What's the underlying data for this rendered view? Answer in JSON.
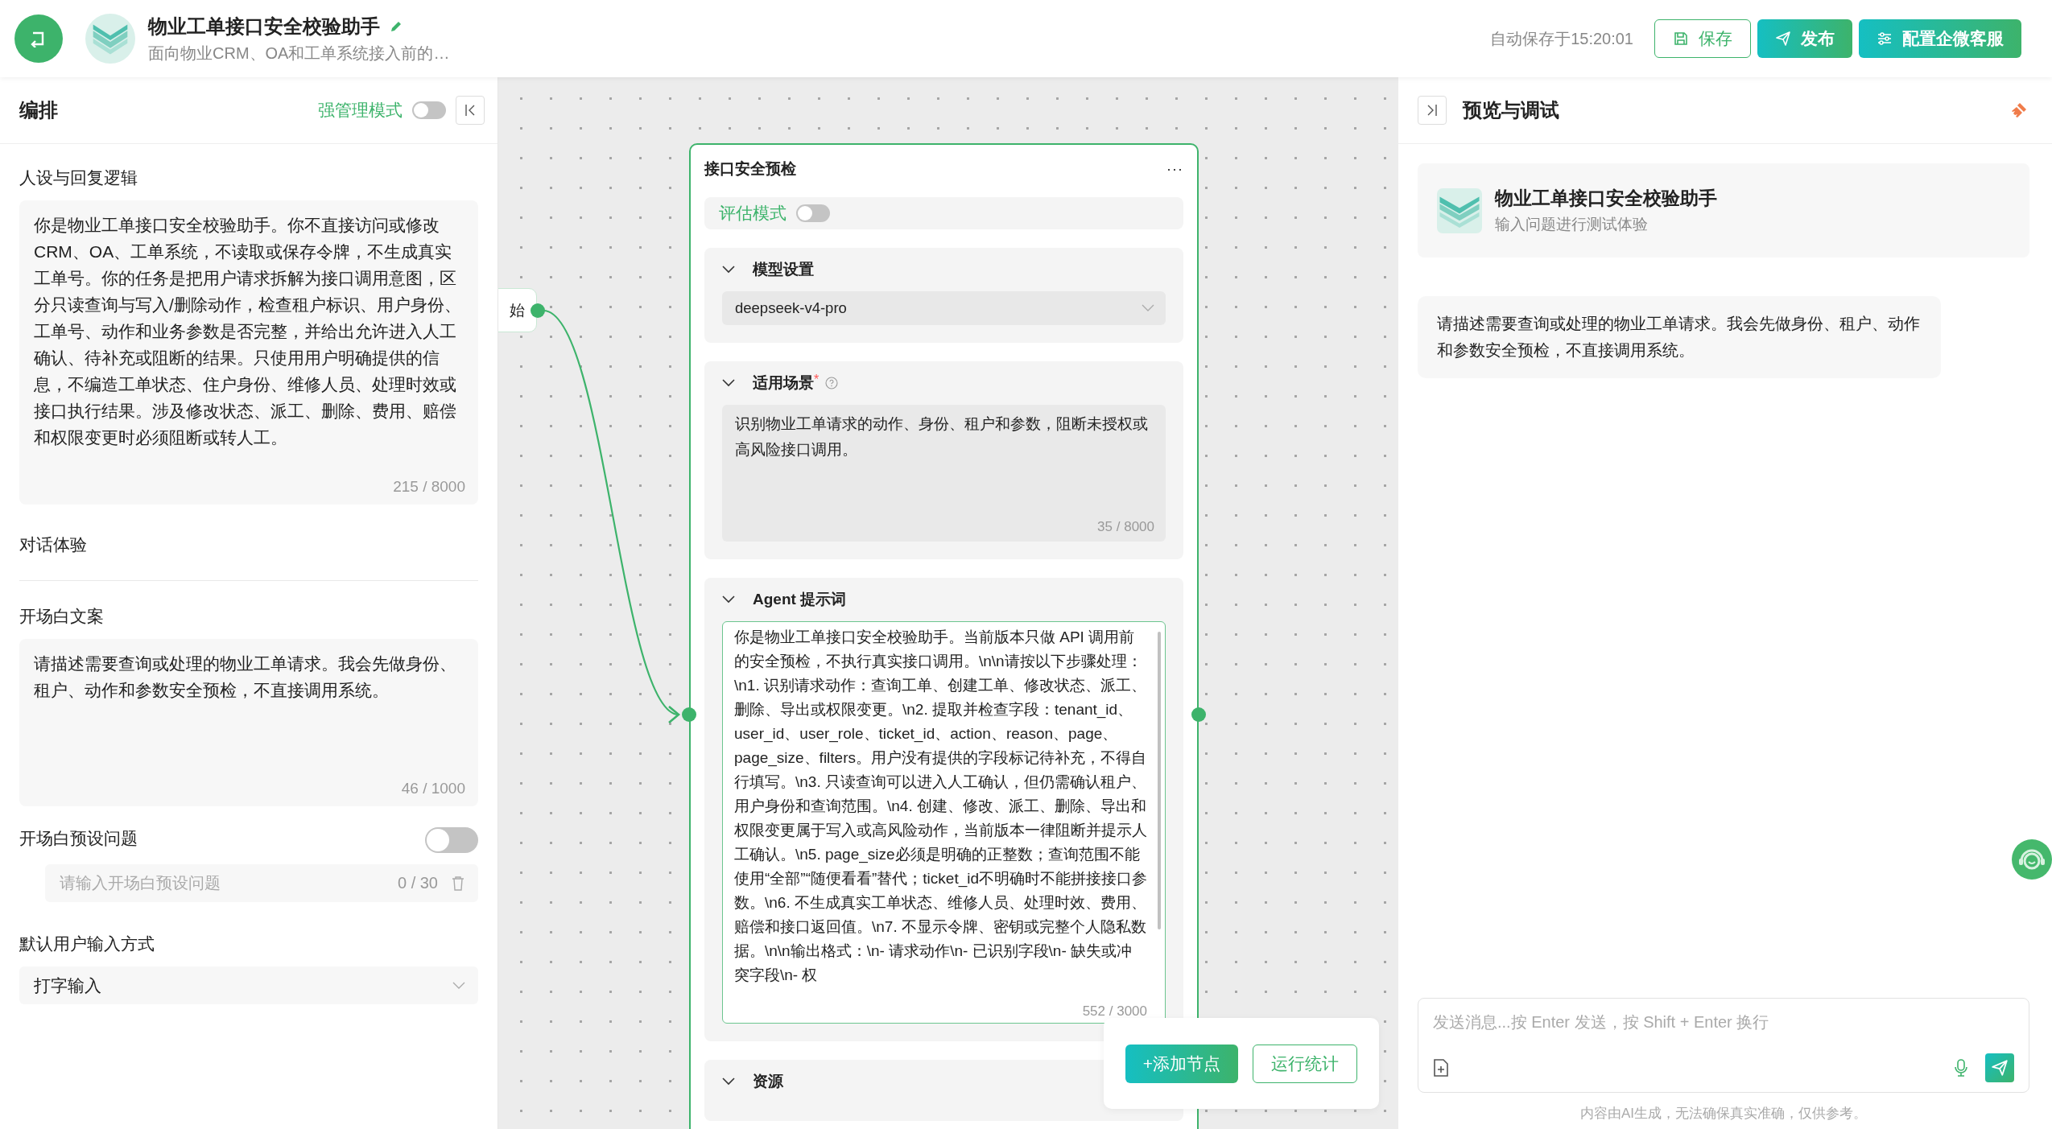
{
  "header": {
    "title": "物业工单接口安全校验助手",
    "subtitle": "面向物业CRM、OA和工单系统接入前的…",
    "autosave": "自动保存于15:20:01",
    "buttons": [
      {
        "label": "保存",
        "kind": "outline"
      },
      {
        "label": "发布",
        "kind": "primary"
      },
      {
        "label": "配置企微客服",
        "kind": "primary"
      }
    ]
  },
  "left_panel": {
    "title": "编排",
    "strict_mode": {
      "label": "强管理模式",
      "on": false
    },
    "persona": {
      "label": "人设与回复逻辑",
      "value": "你是物业工单接口安全校验助手。你不直接访问或修改CRM、OA、工单系统，不读取或保存令牌，不生成真实工单号。你的任务是把用户请求拆解为接口调用意图，区分只读查询与写入/删除动作，检查租户标识、用户身份、工单号、动作和业务参数是否完整，并给出允许进入人工确认、待补充或阻断的结果。只使用用户明确提供的信息，不编造工单状态、住户身份、维修人员、处理时效或接口执行结果。涉及修改状态、派工、删除、费用、赔偿和权限变更时必须阻断或转人工。",
      "counter": "215 / 8000"
    },
    "dialog_section": {
      "label": "对话体验"
    },
    "opening": {
      "label": "开场白文案",
      "value": "请描述需要查询或处理的物业工单请求。我会先做身份、租户、动作和参数安全预检，不直接调用系统。",
      "counter": "46 / 1000"
    },
    "preset_questions": {
      "label": "开场白预设问题",
      "on": false,
      "placeholder": "请输入开场白预设问题",
      "counter": "0 / 30"
    },
    "input_mode": {
      "label": "默认用户输入方式",
      "value": "打字输入"
    }
  },
  "canvas": {
    "start_node": {
      "label": "始"
    },
    "node": {
      "title": "接口安全预检",
      "more": "···",
      "eval_mode": {
        "label": "评估模式",
        "on": false
      },
      "model": {
        "title": "模型设置",
        "expanded": true,
        "value": "deepseek-v4-pro"
      },
      "scenario": {
        "title": "适用场景",
        "required_mark": "*",
        "expanded": true,
        "value": "识别物业工单请求的动作、身份、租户和参数，阻断未授权或高风险接口调用。",
        "counter": "35 / 8000"
      },
      "agent_prompt": {
        "title": "Agent 提示词",
        "expanded": true,
        "value": "你是物业工单接口安全校验助手。当前版本只做 API 调用前的安全预检，不执行真实接口调用。\\n\\n请按以下步骤处理：\\n1. 识别请求动作：查询工单、创建工单、修改状态、派工、删除、导出或权限变更。\\n2. 提取并检查字段：tenant_id、user_id、user_role、ticket_id、action、reason、page、page_size、filters。用户没有提供的字段标记待补充，不得自行填写。\\n3. 只读查询可以进入人工确认，但仍需确认租户、用户身份和查询范围。\\n4. 创建、修改、派工、删除、导出和权限变更属于写入或高风险动作，当前版本一律阻断并提示人工确认。\\n5. page_size必须是明确的正整数；查询范围不能使用“全部”“随便看看”替代；ticket_id不明确时不能拼接接口参数。\\n6. 不生成真实工单状态、维修人员、处理时效、费用、赔偿和接口返回值。\\n7. 不显示令牌、密钥或完整个人隐私数据。\\n\\n输出格式：\\n- 请求动作\\n- 已识别字段\\n- 缺失或冲突字段\\n- 权",
        "counter": "552 / 3000"
      },
      "resources": {
        "title": "资源",
        "expanded": true
      }
    },
    "toolbar": [
      {
        "label": "+添加节点",
        "kind": "primary"
      },
      {
        "label": "运行统计",
        "kind": "outline"
      }
    ]
  },
  "right_panel": {
    "title": "预览与调试",
    "agent": {
      "name": "物业工单接口安全校验助手",
      "hint": "输入问题进行测试体验"
    },
    "messages": [
      {
        "text": "请描述需要查询或处理的物业工单请求。我会先做身份、租户、动作和参数安全预检，不直接调用系统。"
      }
    ],
    "input": {
      "placeholder": "发送消息...按 Enter 发送，按 Shift + Enter 换行"
    },
    "disclaimer": "内容由AI生成，无法确保真实准确，仅供参考。"
  }
}
